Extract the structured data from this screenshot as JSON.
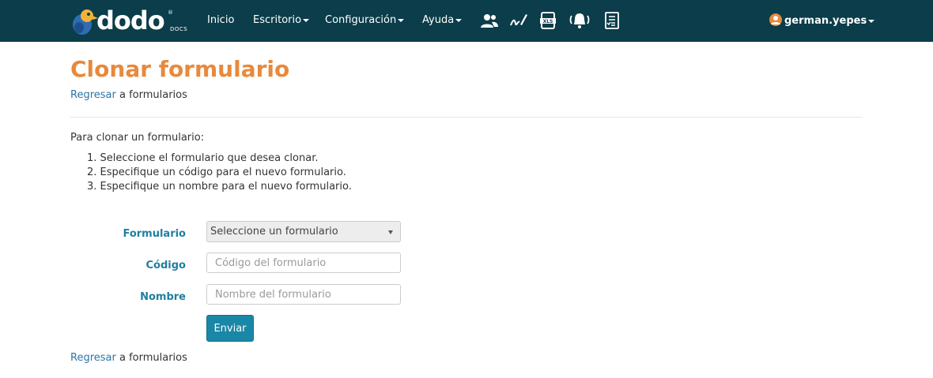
{
  "brand": {
    "word": "dodo",
    "sub": "DOCS",
    "reg": "®"
  },
  "nav": {
    "items": [
      {
        "label": "Inicio",
        "dropdown": false
      },
      {
        "label": "Escritorio",
        "dropdown": true
      },
      {
        "label": "Configuración",
        "dropdown": true
      },
      {
        "label": "Ayuda",
        "dropdown": true
      }
    ],
    "icons": [
      "users-icon",
      "signature-icon",
      "xls-export-icon",
      "notification-bell-icon",
      "document-list-icon"
    ],
    "user": "german.yepes"
  },
  "page": {
    "title": "Clonar formulario",
    "back_link": "Regresar",
    "back_rest": " a formularios",
    "intro": "Para clonar un formulario:",
    "steps": [
      "1. Seleccione el formulario que desea clonar.",
      "2. Especifique un código para el nuevo formulario.",
      "3. Especifique un nombre para el nuevo formulario."
    ]
  },
  "form": {
    "formulario_label": "Formulario",
    "formulario_value": "Seleccione un formulario",
    "codigo_label": "Código",
    "codigo_placeholder": "Código del formulario",
    "nombre_label": "Nombre",
    "nombre_placeholder": "Nombre del formulario",
    "submit": "Enviar"
  },
  "colors": {
    "navbar": "#0b3d4a",
    "title": "#e8893c",
    "label": "#1f7fa1",
    "link": "#2a76a5",
    "button": "#1a87a6"
  }
}
